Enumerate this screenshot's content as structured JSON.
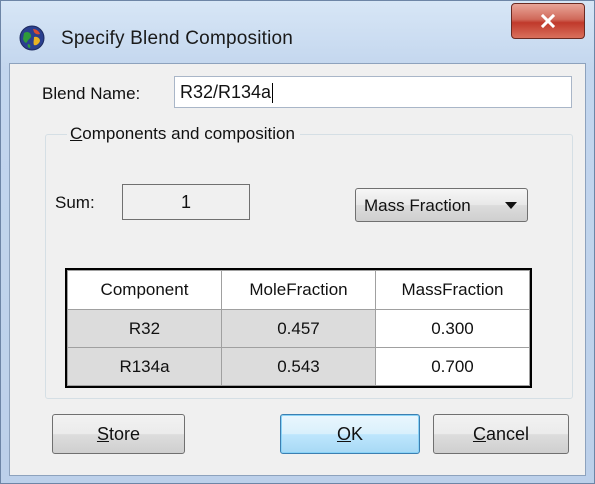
{
  "window": {
    "title": "Specify Blend Composition",
    "close_label": "X"
  },
  "blend_name": {
    "label": "Blend Name:",
    "value": "R32/R134a"
  },
  "group": {
    "legend_first": "C",
    "legend_rest": "omponents and composition"
  },
  "sum": {
    "label": "Sum:",
    "value": "1"
  },
  "basis": {
    "selected": "Mass Fraction"
  },
  "table": {
    "columns": [
      "Component",
      "MoleFraction",
      "MassFraction"
    ],
    "rows": [
      {
        "component": "R32",
        "mole_fraction": "0.457",
        "mass_fraction": "0.300"
      },
      {
        "component": "R134a",
        "mole_fraction": "0.543",
        "mass_fraction": "0.700"
      }
    ]
  },
  "buttons": {
    "store_first": "S",
    "store_rest": "tore",
    "ok_first": "O",
    "ok_rest": "K",
    "cancel_first": "C",
    "cancel_rest": "ancel"
  },
  "colors": {
    "title_gradient_top": "#d7e6f6",
    "close_button_red": "#c0392b",
    "client_background": "#f0f0f0",
    "default_button_blue": "#3c7fb1"
  },
  "icons": {
    "title": "globe-icon",
    "close": "close-icon",
    "dropdown": "chevron-down-icon"
  }
}
